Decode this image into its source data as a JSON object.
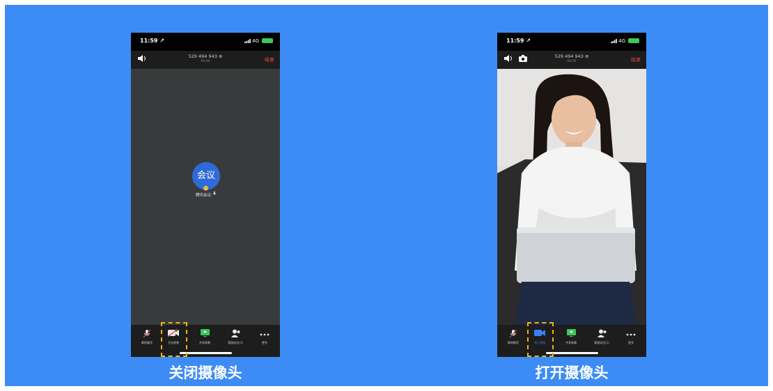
{
  "left_phone": {
    "status": {
      "time": "11:59 ↗",
      "network": "4G"
    },
    "header": {
      "meeting_id": "529 494 943 ⊕",
      "duration": "00:00",
      "end_label": "结束"
    },
    "avatar_text": "会议",
    "participant_name": "腾讯会议",
    "toolbar": {
      "mute_label": "解除静音",
      "camera_label": "开启视频",
      "share_label": "共享屏幕",
      "members_label": "管理成员(1)",
      "more_label": "更多"
    },
    "caption": "关闭摄像头"
  },
  "right_phone": {
    "status": {
      "time": "11:59 ↗",
      "network": "4G"
    },
    "header": {
      "meeting_id": "529 494 943 ⊕",
      "duration": "00:00",
      "end_label": "结束"
    },
    "toolbar": {
      "mute_label": "解除静音",
      "camera_label": "停止视频",
      "share_label": "共享屏幕",
      "members_label": "管理成员(1)",
      "more_label": "更多"
    },
    "caption": "打开摄像头"
  },
  "colors": {
    "background": "#3d8cf5",
    "highlight": "#f2b30f",
    "end_red": "#e5484d",
    "active_blue": "#3d7df5"
  },
  "icons": [
    "speaker-icon",
    "camera-flip-icon",
    "mic-icon",
    "video-off-icon",
    "video-icon",
    "share-screen-icon",
    "members-icon",
    "more-icon"
  ]
}
